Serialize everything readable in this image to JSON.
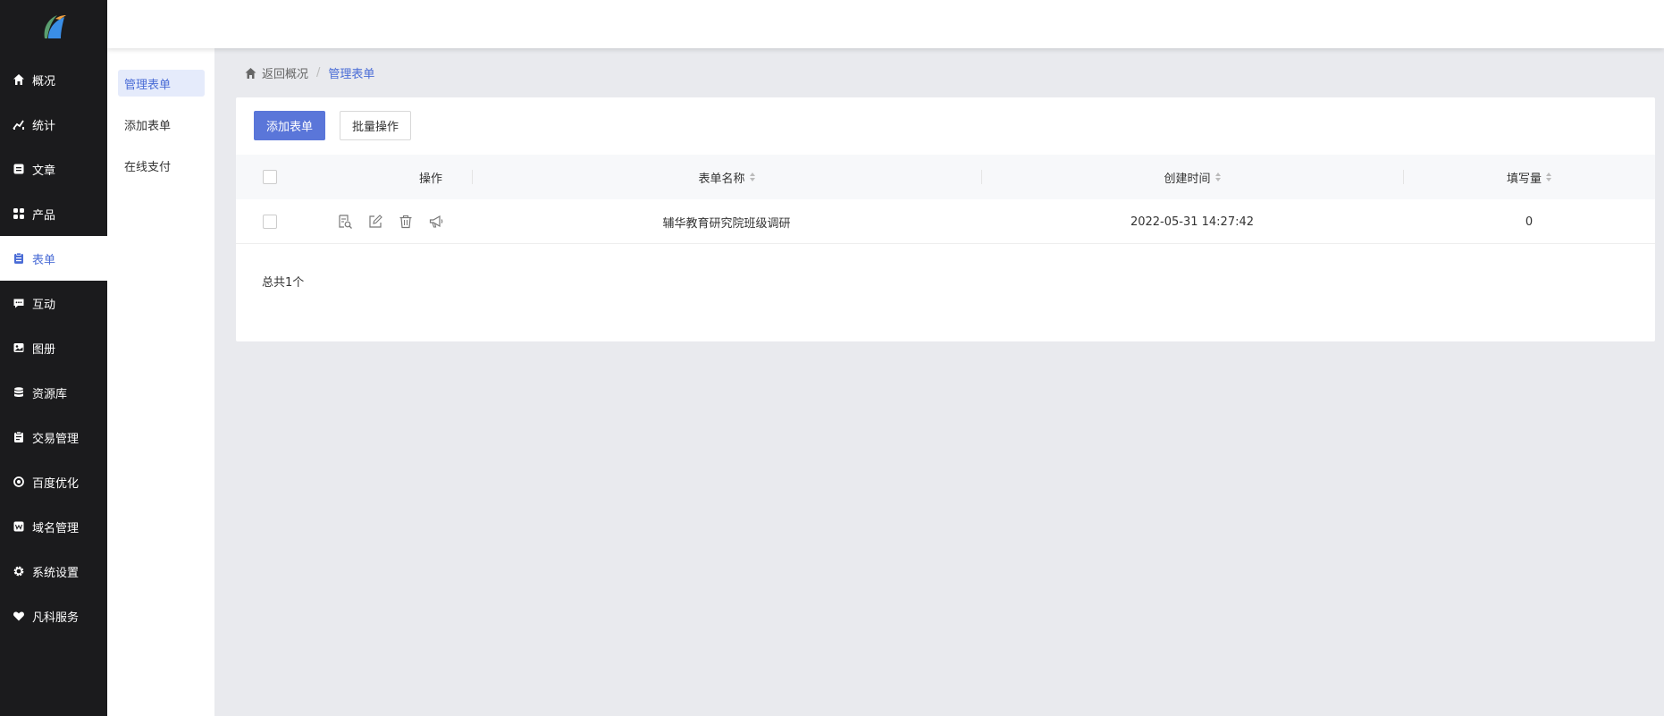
{
  "sidebar": {
    "items": [
      {
        "label": "概况",
        "icon": "home-icon"
      },
      {
        "label": "统计",
        "icon": "stats-icon"
      },
      {
        "label": "文章",
        "icon": "article-icon"
      },
      {
        "label": "产品",
        "icon": "grid-icon"
      },
      {
        "label": "表单",
        "icon": "clipboard-icon",
        "active": true
      },
      {
        "label": "互动",
        "icon": "chat-icon"
      },
      {
        "label": "图册",
        "icon": "image-icon"
      },
      {
        "label": "资源库",
        "icon": "database-icon"
      },
      {
        "label": "交易管理",
        "icon": "order-icon"
      },
      {
        "label": "百度优化",
        "icon": "seo-icon"
      },
      {
        "label": "域名管理",
        "icon": "domain-icon"
      },
      {
        "label": "系统设置",
        "icon": "gear-icon"
      },
      {
        "label": "凡科服务",
        "icon": "heart-icon"
      }
    ]
  },
  "submenu": {
    "items": [
      {
        "label": "管理表单",
        "active": true
      },
      {
        "label": "添加表单"
      },
      {
        "label": "在线支付"
      }
    ]
  },
  "breadcrumb": {
    "back_label": "返回概况",
    "separator": "/",
    "current": "管理表单"
  },
  "toolbar": {
    "add_label": "添加表单",
    "batch_label": "批量操作"
  },
  "table": {
    "headers": {
      "actions": "操作",
      "name": "表单名称",
      "created": "创建时间",
      "count": "填写量"
    },
    "rows": [
      {
        "name": "辅华教育研究院班级调研",
        "created": "2022-05-31 14:27:42",
        "count": "0"
      }
    ],
    "row_actions": [
      "preview-icon",
      "edit-icon",
      "delete-icon",
      "promote-icon"
    ]
  },
  "footer": {
    "total": "总共1个"
  },
  "colors": {
    "sidebar_bg": "#1b1b1d",
    "accent": "#4a6cd6",
    "primary_button": "#5a76d9",
    "page_bg": "#e9eaee"
  }
}
